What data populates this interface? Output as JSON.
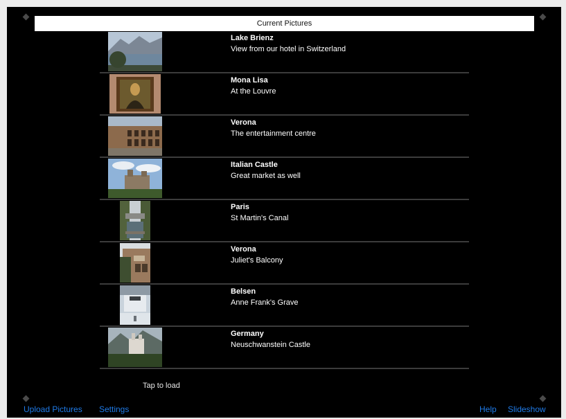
{
  "header": {
    "title": "Current Pictures"
  },
  "pictures": [
    {
      "title": "Lake Brienz",
      "caption": "View from our hotel in Switzerland"
    },
    {
      "title": "Mona Lisa",
      "caption": "At the Louvre"
    },
    {
      "title": "Verona",
      "caption": "The entertainment centre"
    },
    {
      "title": "Italian Castle",
      "caption": "Great market as well"
    },
    {
      "title": "Paris",
      "caption": "St Martin's Canal"
    },
    {
      "title": "Verona",
      "caption": "Juliet's Balcony"
    },
    {
      "title": "Belsen",
      "caption": "Anne Frank's Grave"
    },
    {
      "title": "Germany",
      "caption": "Neuschwanstein Castle"
    }
  ],
  "footer": {
    "tap_to_load": "Tap to load"
  },
  "toolbar": {
    "upload_label": "Upload Pictures",
    "settings_label": "Settings",
    "help_label": "Help",
    "slideshow_label": "Slideshow"
  },
  "colors": {
    "accent": "#1f7be8",
    "background": "#000000",
    "separator": "#3c3c3c"
  }
}
